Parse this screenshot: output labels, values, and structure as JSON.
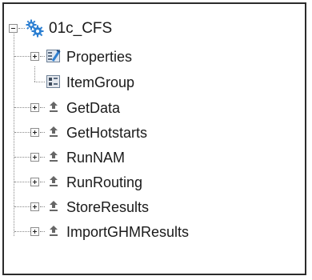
{
  "tree": {
    "root": {
      "label": "01c_CFS",
      "icon": "gear-cluster-icon",
      "expanded": true
    },
    "children": [
      {
        "label": "Properties",
        "icon": "properties-icon",
        "expander": "plus"
      },
      {
        "label": "ItemGroup",
        "icon": "item-group-icon",
        "expander": "none"
      },
      {
        "label": "GetData",
        "icon": "tool-icon",
        "expander": "plus"
      },
      {
        "label": "GetHotstarts",
        "icon": "tool-icon",
        "expander": "plus"
      },
      {
        "label": "RunNAM",
        "icon": "tool-icon",
        "expander": "plus"
      },
      {
        "label": "RunRouting",
        "icon": "tool-icon",
        "expander": "plus"
      },
      {
        "label": "StoreResults",
        "icon": "tool-icon",
        "expander": "plus"
      },
      {
        "label": "ImportGHMResults",
        "icon": "tool-icon",
        "expander": "plus"
      }
    ]
  },
  "colors": {
    "border": "#2b2b2b",
    "gear_blue": "#2c7fd2",
    "text": "#1a1a1a"
  }
}
